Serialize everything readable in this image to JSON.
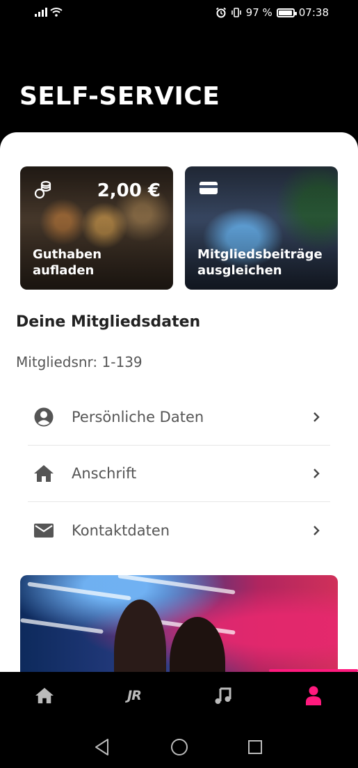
{
  "status_bar": {
    "battery_percent": "97 %",
    "time": "07:38",
    "battery_level": 0.97
  },
  "header": {
    "title": "SELF-SERVICE"
  },
  "tiles": [
    {
      "label": "Guthaben aufladen",
      "value": "2,00 €",
      "icon": "coins-icon"
    },
    {
      "label": "Mitgliedsbeiträge ausgleichen",
      "icon": "card-icon"
    }
  ],
  "member": {
    "section_title": "Deine Mitgliedsdaten",
    "member_number": "Mitgliedsnr: 1-139"
  },
  "menu": [
    {
      "label": "Persönliche Daten",
      "icon": "person-circle-icon"
    },
    {
      "label": "Anschrift",
      "icon": "home-icon"
    },
    {
      "label": "Kontaktdaten",
      "icon": "mail-icon"
    }
  ],
  "bottom_nav": {
    "items": [
      {
        "icon": "home-icon"
      },
      {
        "text": "JR",
        "icon": "logo-icon"
      },
      {
        "icon": "music-note-icon"
      },
      {
        "icon": "profile-icon",
        "active": true
      }
    ],
    "active_color": "#ff1a7e",
    "inactive_color": "#bbbbbb"
  },
  "system_nav": {
    "items": [
      "back-icon",
      "home-circle-icon",
      "recents-icon"
    ]
  }
}
